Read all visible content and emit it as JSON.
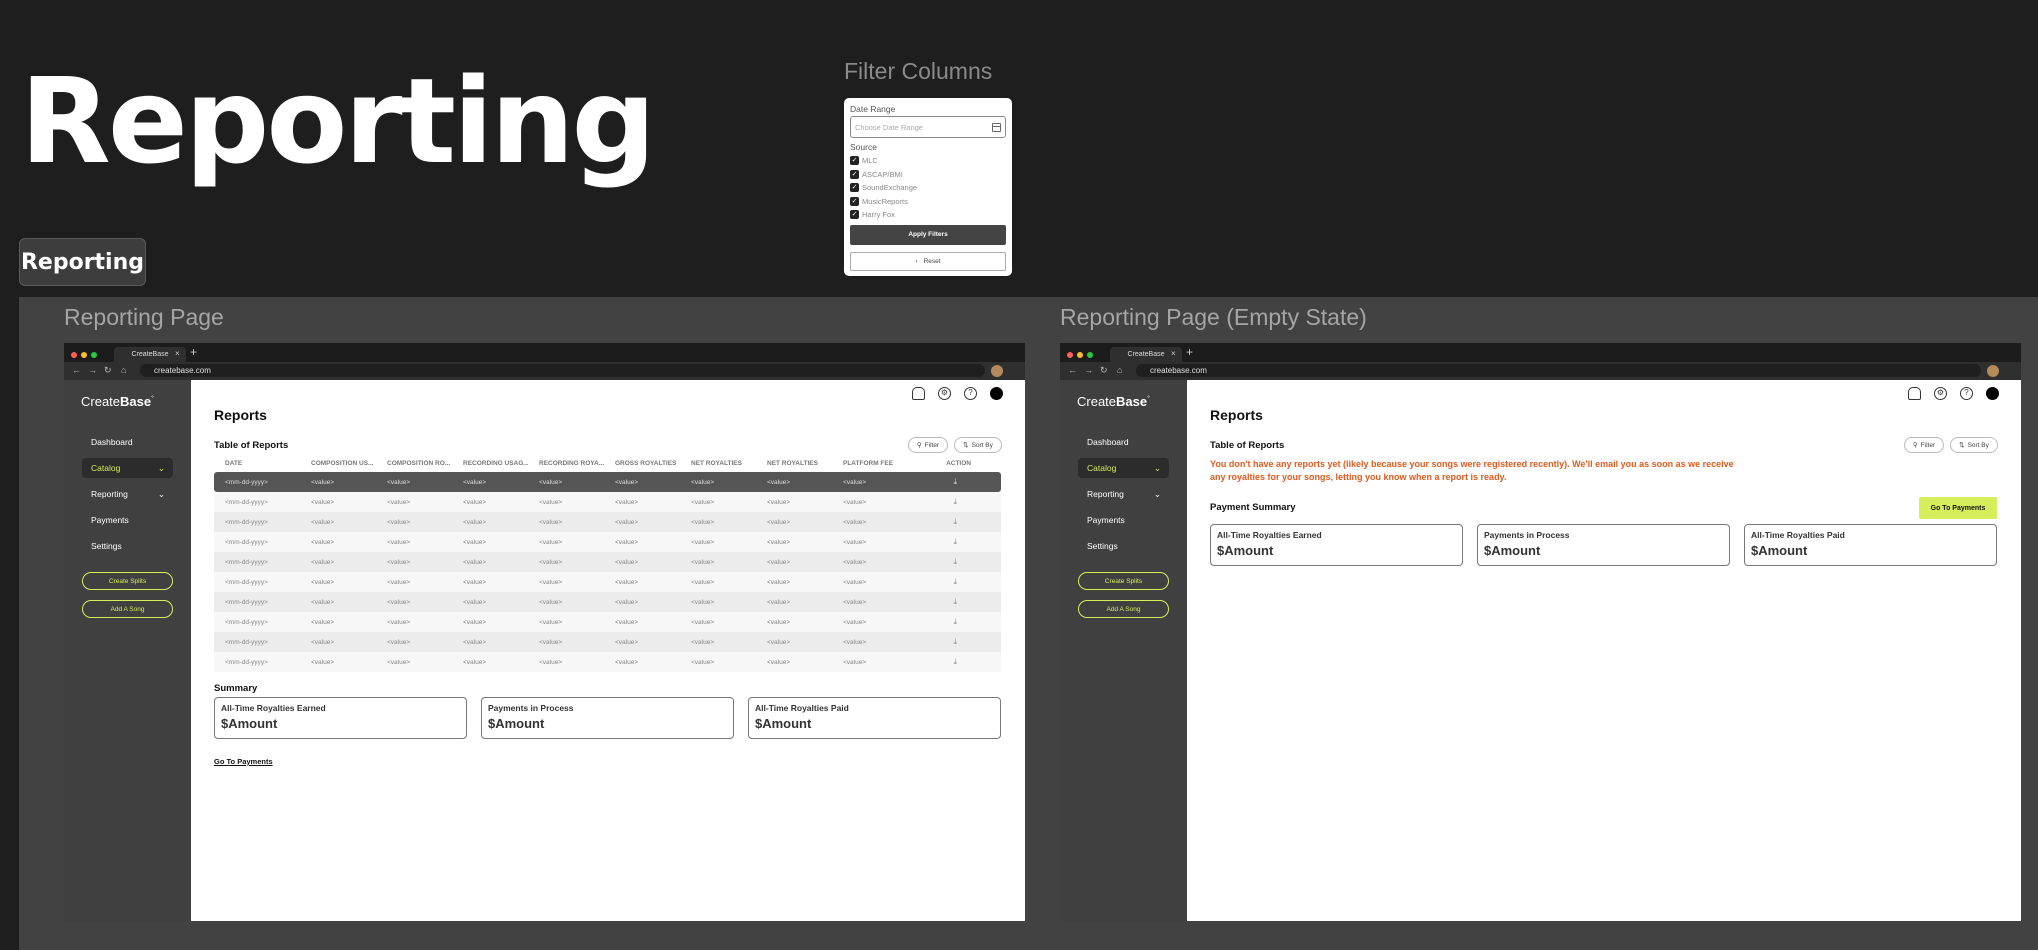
{
  "hero": {
    "title": "Reporting",
    "pill_label": "Reporting"
  },
  "filter_panel": {
    "heading": "Filter Columns",
    "date_range_label": "Date Range",
    "date_placeholder": "Choose Date Range",
    "source_label": "Source",
    "sources": [
      "MLC",
      "ASCAP/BMI",
      "SoundExchange",
      "MusicReports",
      "Harry Fox"
    ],
    "apply_label": "Apply Filters",
    "reset_label": "Reset"
  },
  "frames": {
    "main_title": "Reporting Page",
    "empty_title": "Reporting Page (Empty State)"
  },
  "browser": {
    "tab_title": "CreateBase",
    "url": "createbase.com"
  },
  "sidebar": {
    "logo_light": "Create",
    "logo_bold": "Base",
    "logo_mark": "°",
    "items": [
      "Dashboard",
      "Catalog",
      "Reporting",
      "Payments",
      "Settings"
    ],
    "create_splits": "Create Splits",
    "add_song": "Add A Song"
  },
  "reports": {
    "title": "Reports",
    "table_title": "Table of Reports",
    "filter_label": "Filter",
    "sort_label": "Sort By",
    "columns": [
      "DATE",
      "COMPOSITION US...",
      "COMPOSITION RO...",
      "RECORDING USAG...",
      "RECORDING ROYA...",
      "GROSS ROYALTIES",
      "NET ROYALTIES",
      "NET ROYALTIES",
      "PLATFORM FEE",
      "ACTION"
    ],
    "row_date": "<mm-dd-yyyy>",
    "row_value": "<value>",
    "summary_title": "Summary",
    "go_to_payments": "Go To Payments"
  },
  "summary_cards": [
    {
      "label": "All-Time Royalties Earned",
      "value": "$Amount"
    },
    {
      "label": "Payments in Process",
      "value": "$Amount"
    },
    {
      "label": "All-Time Royalties Paid",
      "value": "$Amount"
    }
  ],
  "empty_state": {
    "message": "You don't have any reports yet (likely because your songs were registered recently). We'll email you as soon as we receive any royalties for your songs, letting you know when a report is ready.",
    "payment_summary_title": "Payment Summary",
    "go_to_payments_button": "Go To Payments"
  },
  "colors": {
    "accent": "#d7ee5c",
    "warning": "#e15a1d",
    "sidebar": "#404040",
    "background": "#1e1e1e"
  }
}
